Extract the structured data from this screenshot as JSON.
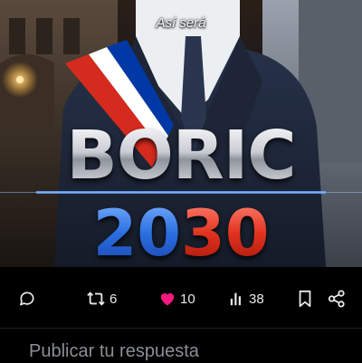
{
  "post": {
    "image": {
      "caption": "Así será",
      "headline_line1": "BORIC",
      "headline_year_part1": "20",
      "headline_year_part2": "30",
      "colors": {
        "sash_red": "#d52b1e",
        "sash_white": "#ffffff",
        "sash_blue": "#0039a6",
        "suit": "#1b2230"
      }
    },
    "actions": {
      "reply_icon": "speech-bubble-icon",
      "repost_icon": "repost-arrows-icon",
      "repost_count": "6",
      "like_icon": "heart-icon",
      "like_count": "10",
      "like_color": "#f91880",
      "views_icon": "bar-chart-icon",
      "views_count": "38",
      "bookmark_icon": "bookmark-icon",
      "share_icon": "share-icon"
    }
  },
  "reply_box": {
    "placeholder": "Publicar tu respuesta"
  }
}
